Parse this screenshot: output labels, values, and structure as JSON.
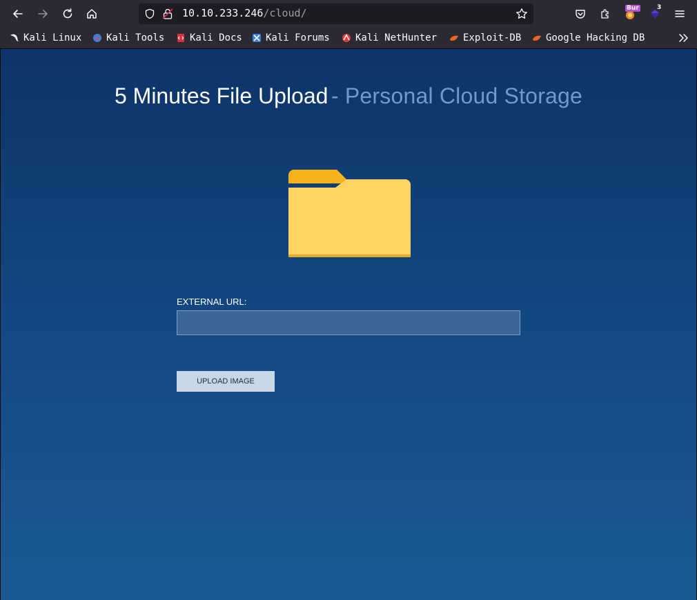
{
  "browser": {
    "url_host": "10.10.233.246",
    "url_path": "/cloud/",
    "extensions": {
      "burp_badge": "Bur",
      "count_badge": "3"
    }
  },
  "bookmarks": [
    {
      "label": "Kali Linux",
      "icon": "kali-dragon-icon"
    },
    {
      "label": "Kali Tools",
      "icon": "kali-tools-icon"
    },
    {
      "label": "Kali Docs",
      "icon": "kali-docs-icon"
    },
    {
      "label": "Kali Forums",
      "icon": "kali-forums-icon"
    },
    {
      "label": "Kali NetHunter",
      "icon": "kali-nethunter-icon"
    },
    {
      "label": "Exploit-DB",
      "icon": "exploit-db-icon"
    },
    {
      "label": "Google Hacking DB",
      "icon": "exploit-db-icon"
    }
  ],
  "page": {
    "title_main": "5 Minutes File Upload",
    "title_sub": "- Personal Cloud Storage",
    "url_label": "EXTERNAL URL:",
    "url_value": "",
    "upload_button": "UPLOAD IMAGE",
    "folder_icon": "folder-icon"
  },
  "colors": {
    "page_top": "#0d3468",
    "page_bottom": "#1a5a94",
    "folder_tab": "#f7b21b",
    "folder_body": "#fcd462",
    "button_bg": "#c8d7e6"
  }
}
